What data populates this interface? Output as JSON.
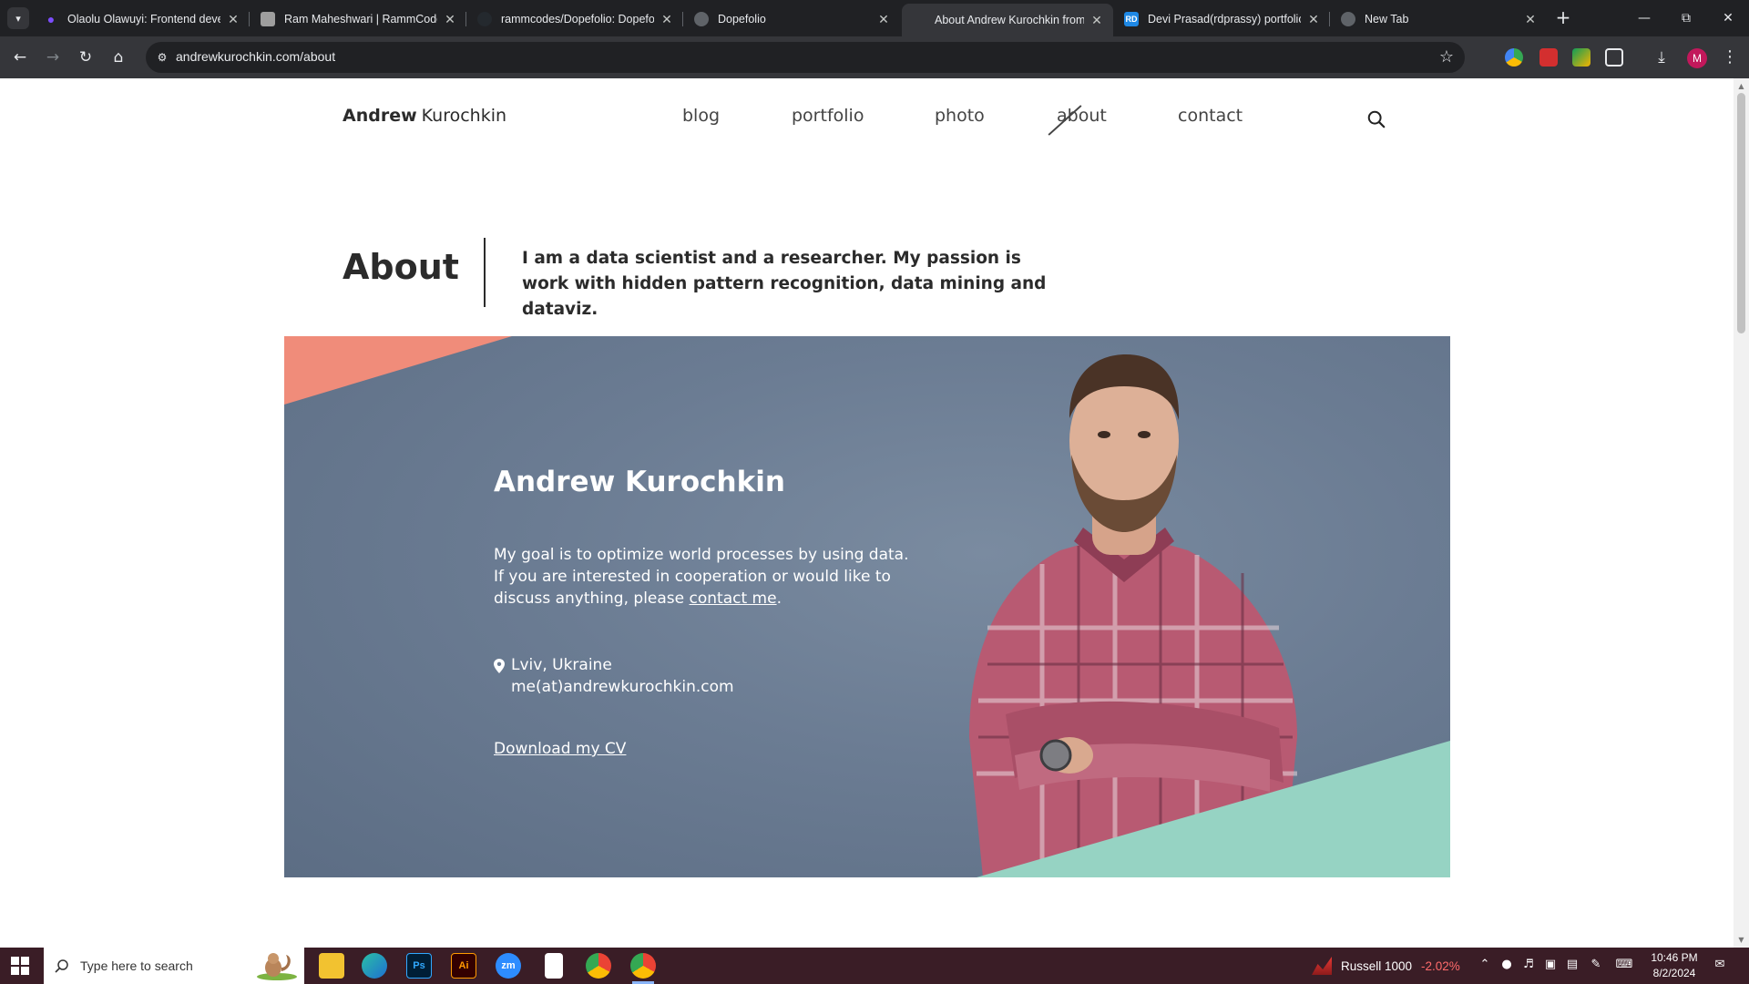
{
  "browser": {
    "tabs": [
      {
        "title": "Olaolu Olawuyi: Frontend deve",
        "favicon_color": "#7c4dff"
      },
      {
        "title": "Ram Maheshwari | RammCodes",
        "favicon_color": "#9e9e9e"
      },
      {
        "title": "rammcodes/Dopefolio: Dopefo",
        "favicon_color": "#24292e"
      },
      {
        "title": "Dopefolio",
        "favicon_color": "#5f6368"
      },
      {
        "title": "About Andrew Kurochkin from",
        "favicon_color": "#35363a"
      },
      {
        "title": "Devi Prasad(rdprassy) portfolio",
        "favicon_color": "#1e88e5",
        "favicon_text": "RD"
      },
      {
        "title": "New Tab",
        "favicon_color": "#5f6368"
      }
    ],
    "active_tab_index": 4,
    "url": "andrewkurochkin.com/about",
    "profile_initial": "M"
  },
  "site": {
    "logo_bold": "Andrew",
    "logo_light": "Kurochkin",
    "nav": [
      "blog",
      "portfolio",
      "photo",
      "about",
      "contact"
    ],
    "active_nav": "about"
  },
  "about": {
    "title": "About",
    "lead": "I am a data scientist and a researcher. My passion is work with hidden pattern recognition, data mining and dataviz."
  },
  "hero": {
    "name": "Andrew Kurochkin",
    "goal_text": "My goal is to optimize world processes by using data. If you are interested in cooperation or would like to discuss anything, please",
    "contact_link": "contact me",
    "goal_end": ".",
    "location": "Lviv, Ukraine",
    "email": "me(at)andrewkurochkin.com",
    "cv_link": "Download my CV",
    "colors": {
      "background": "#6b7c93",
      "coral": "#f08c7a",
      "mint": "#96d3c3"
    }
  },
  "taskbar": {
    "search_placeholder": "Type here to search",
    "apps": [
      "file-explorer",
      "edge",
      "photoshop",
      "illustrator",
      "zoom",
      "notepad",
      "chrome",
      "chrome-profile"
    ],
    "app_labels": {
      "photoshop": "Ps",
      "illustrator": "Ai",
      "zoom": "zm"
    },
    "stock_name": "Russell 1000",
    "stock_change": "-2.02%",
    "time": "10:46 PM",
    "date": "8/2/2024"
  }
}
